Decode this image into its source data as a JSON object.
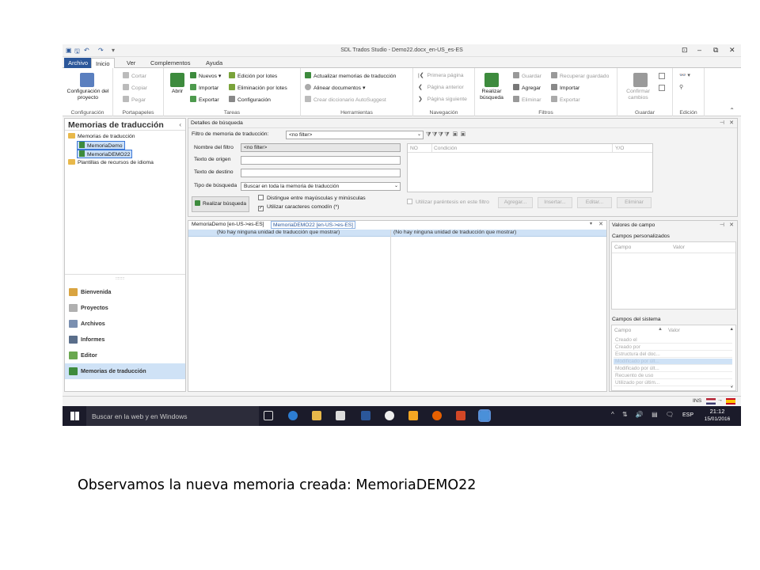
{
  "app": {
    "title": "SDL Trados Studio - Demo22.docx_en-US_es-ES"
  },
  "ribbon_tabs": [
    "Archivo",
    "Inicio",
    "Ver",
    "Complementos",
    "Ayuda"
  ],
  "ribbon": {
    "configuracion": {
      "big": "Configuración del proyecto",
      "group": "Configuración"
    },
    "portapapeles": {
      "cortar": "Cortar",
      "copiar": "Copiar",
      "pegar": "Pegar",
      "group": "Portapapeles"
    },
    "tareas": {
      "abrir": "Abrir",
      "nuevos": "Nuevos",
      "importar": "Importar",
      "exportar": "Exportar",
      "edicion_lotes": "Edición por lotes",
      "eliminacion_lotes": "Eliminación por lotes",
      "configuracion": "Configuración",
      "group": "Tareas"
    },
    "herramientas": {
      "actualizar": "Actualizar memorias de traducción",
      "alinear": "Alinear documentos",
      "crear_diccionario": "Crear diccionario AutoSuggest",
      "group": "Herramientas"
    },
    "navegacion": {
      "primera": "Primera página",
      "anterior": "Página anterior",
      "siguiente": "Página siguiente",
      "group": "Navegación"
    },
    "filtros": {
      "realizar": "Realizar búsqueda",
      "guardar": "Guardar",
      "agregar": "Agregar",
      "eliminar": "Eliminar",
      "recuperar": "Recuperar guardado",
      "importar": "Importar",
      "exportar": "Exportar",
      "group": "Filtros"
    },
    "guardar": {
      "confirmar": "Confirmar cambios",
      "group": "Guardar"
    },
    "edicion": {
      "group": "Edición"
    }
  },
  "left_panel": {
    "title": "Memorias de traducción",
    "tree": {
      "root": "Memorias de traducción",
      "items": [
        "MemoriaDemo",
        "MemoriaDEMO22"
      ],
      "plantillas": "Plantillas de recursos de idioma"
    },
    "nav": [
      "Bienvenida",
      "Proyectos",
      "Archivos",
      "Informes",
      "Editor",
      "Memorias de traducción"
    ]
  },
  "search": {
    "header": "Detalles de búsqueda",
    "filter_label": "Filtro de memoria de traducción:",
    "filter_value": "<no filter>",
    "nombre_label": "Nombre del filtro",
    "nombre_value": "<no filter>",
    "origen_label": "Texto de origen",
    "destino_label": "Texto de destino",
    "tipo_label": "Tipo de búsqueda",
    "tipo_value": "Buscar en toda la memoria de traducción",
    "chk_mayus": "Distingue entre mayúsculas y minúsculas",
    "chk_comodin": "Utilizar caracteres comodín (*)",
    "search_button": "Realizar búsqueda",
    "cond_cols": [
      "NO",
      "Condición",
      "Y/O"
    ],
    "chk_parentesis": "Utilizar paréntesis en este filtro",
    "buttons": [
      "Agregar...",
      "Insertar...",
      "Editar...",
      "Eliminar"
    ]
  },
  "editor": {
    "tabs": [
      "MemoriaDemo [en-US->es-ES]",
      "MemoriaDEMO22 [en-US->es-ES]"
    ],
    "empty_left": "(No hay ninguna unidad de traducción que mostrar)",
    "empty_right": "(No hay ninguna unidad de traducción que mostrar)"
  },
  "field_values": {
    "title": "Valores de campo",
    "custom_header": "Campos personalizados",
    "custom_cols": [
      "Campo",
      "Valor"
    ],
    "system_header": "Campos del sistema",
    "system_cols": [
      "Campo",
      "Valor"
    ],
    "system_rows": [
      "Creado el",
      "Creado por",
      "Estructura del doc...",
      "Modificado por últ...",
      "Modificado por últ...",
      "Recuento de uso",
      "Utilizado por últim..."
    ]
  },
  "status": {
    "ins": "INS"
  },
  "taskbar": {
    "search": "Buscar en la web y en Windows",
    "lang": "ESP",
    "time": "21:12",
    "date": "15/01/2016"
  },
  "caption": "Observamos la nueva memoria creada: MemoriaDEMO22"
}
